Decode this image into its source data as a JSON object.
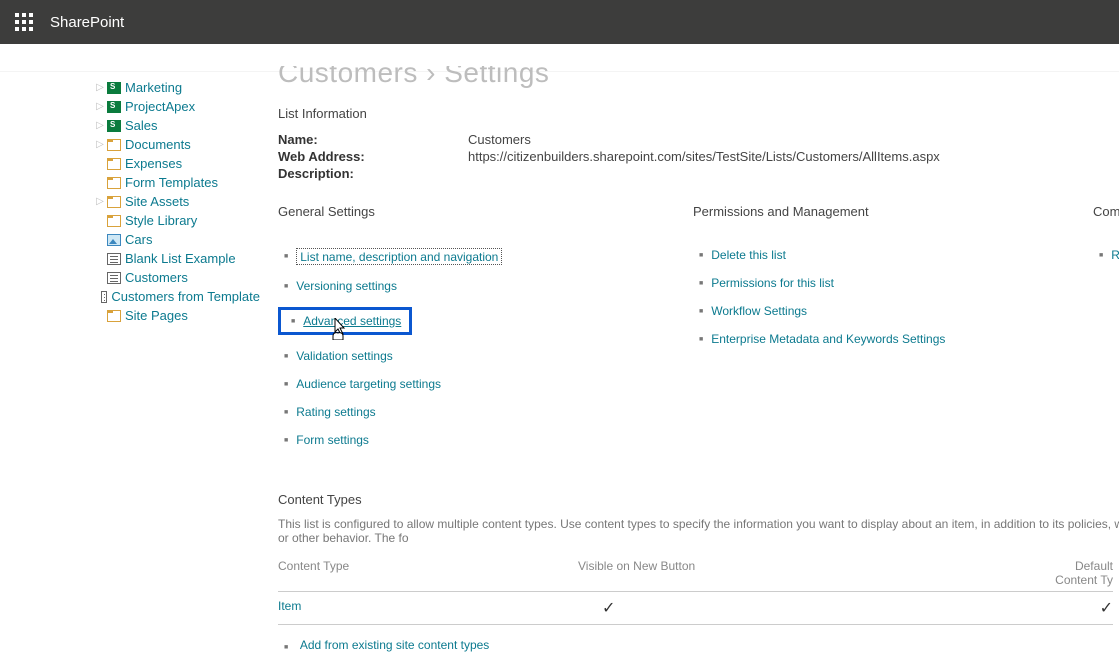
{
  "header": {
    "brand": "SharePoint"
  },
  "nav": [
    {
      "label": "Marketing",
      "icon": "sp",
      "expandable": true
    },
    {
      "label": "ProjectApex",
      "icon": "sp",
      "expandable": true
    },
    {
      "label": "Sales",
      "icon": "sp",
      "expandable": true
    },
    {
      "label": "Documents",
      "icon": "folder",
      "expandable": true
    },
    {
      "label": "Expenses",
      "icon": "folder",
      "expandable": false
    },
    {
      "label": "Form Templates",
      "icon": "folder",
      "expandable": false
    },
    {
      "label": "Site Assets",
      "icon": "folder",
      "expandable": true
    },
    {
      "label": "Style Library",
      "icon": "folder",
      "expandable": false
    },
    {
      "label": "Cars",
      "icon": "img",
      "expandable": false
    },
    {
      "label": "Blank List Example",
      "icon": "list",
      "expandable": false
    },
    {
      "label": "Customers",
      "icon": "list",
      "expandable": false
    },
    {
      "label": "Customers from Template",
      "icon": "list",
      "expandable": false
    },
    {
      "label": "Site Pages",
      "icon": "folder",
      "expandable": false
    }
  ],
  "page_title": "Customers › Settings",
  "list_info_heading": "List Information",
  "info": {
    "name_label": "Name:",
    "name_value": "Customers",
    "web_label": "Web Address:",
    "web_value": "https://citizenbuilders.sharepoint.com/sites/TestSite/Lists/Customers/AllItems.aspx",
    "desc_label": "Description:"
  },
  "columns": {
    "general": {
      "heading": "General Settings",
      "links": [
        "List name, description and navigation",
        "Versioning settings",
        "Advanced settings",
        "Validation settings",
        "Audience targeting settings",
        "Rating settings",
        "Form settings"
      ]
    },
    "perms": {
      "heading": "Permissions and Management",
      "links": [
        "Delete this list",
        "Permissions for this list",
        "Workflow Settings",
        "Enterprise Metadata and Keywords Settings"
      ]
    },
    "comm": {
      "heading": "Comm",
      "links": [
        "RSS"
      ]
    }
  },
  "content_types": {
    "heading": "Content Types",
    "description": "This list is configured to allow multiple content types. Use content types to specify the information you want to display about an item, in addition to its policies, workflows, or other behavior. The fo",
    "col1": "Content Type",
    "col2": "Visible on New Button",
    "col3": "Default Content Ty",
    "row1": "Item",
    "add_link": "Add from existing site content types"
  }
}
